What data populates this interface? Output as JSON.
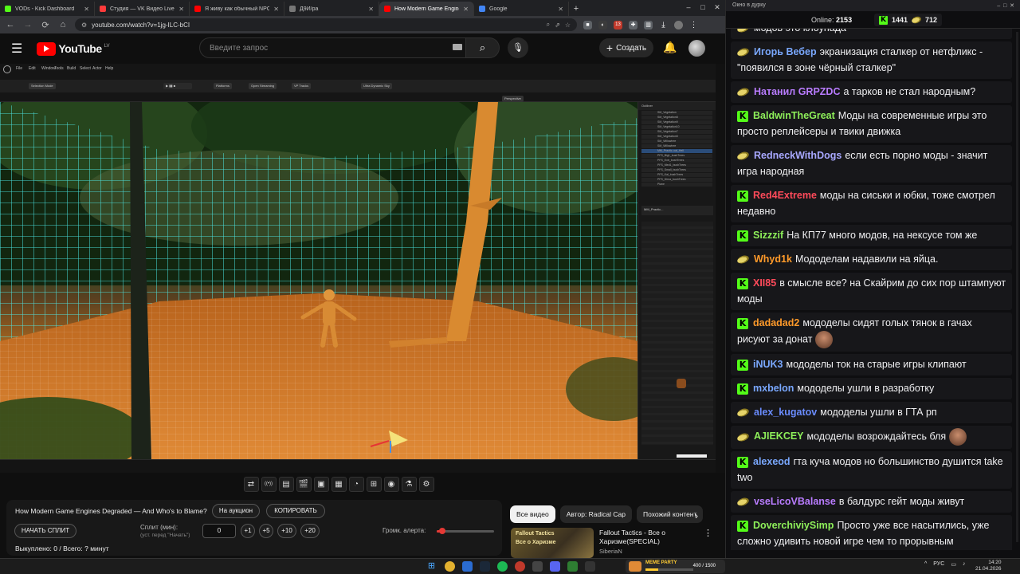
{
  "browser": {
    "tabs": [
      {
        "title": "VODs - Kick Dashboard",
        "color": "#53fc18"
      },
      {
        "title": "Студия — VK Видео Live",
        "color": "#ff3b3b"
      },
      {
        "title": "Я живу как обычный NPC в Ки",
        "color": "#ff0000"
      },
      {
        "title": "Д9И/ра",
        "color": "#777777"
      },
      {
        "title": "How Modern Game Engines De",
        "color": "#ff0000",
        "active": true
      },
      {
        "title": "Google",
        "color": "#4285f4"
      }
    ],
    "new_tab": "+",
    "url": "youtube.com/watch?v=1jg-ILC-bCI",
    "extension_badge": "13"
  },
  "youtube": {
    "logo": "YouTube",
    "country": "LV",
    "search_placeholder": "Введите запрос",
    "create_label": "Создать"
  },
  "ue": {
    "menu": [
      "File",
      "Edit",
      "Window",
      "Tools",
      "Build",
      "Select",
      "Actor",
      "Help"
    ],
    "toolbar": [
      "Selection Mode",
      "Platforms",
      "Open Streaming",
      "VP Tracks",
      "Ultra Dynamic Sky"
    ],
    "viewport_label": "Perspective",
    "outliner_rows": [
      "SM_Vegetation",
      "SM_Vegetation8",
      "SM_Vegetation9",
      "SM_Vegetation10",
      "SM_Vegetation7",
      "SM_Vegetation5",
      "SM_Willowtree",
      "SM_Willowtree",
      "MM_Practic..cal_Hell",
      "PFS_Big1_bushTrees",
      "PFS_Extr_bushTrees",
      "PFS_Med1_bushTrees",
      "PFS_Small_bushTrees",
      "PFS_Kal_bushTrees",
      "PFS_Dirna_bushTrees",
      "Plane"
    ],
    "selection": "MM_Practic..."
  },
  "controls": {
    "icons": [
      "repeat-icon",
      "broadcast-icon",
      "playlist-play-icon",
      "clapperboard-icon",
      "picture-in-picture-icon",
      "film-icon",
      "speed-icon",
      "add-box-icon",
      "camera-icon",
      "flask-icon",
      "gear-icon"
    ]
  },
  "panel": {
    "video_title": "How Modern Game Engines Degraded — And Who's to Blame?",
    "auction_label": "На аукцион",
    "copy_label": "КОПИРОВАТЬ",
    "start_split_label": "НАЧАТЬ СПЛИТ",
    "split_label": "Сплит (мин):",
    "split_hint": "(уст. перед \"Начать\")",
    "split_value": "0",
    "inc_buttons": [
      "+1",
      "+5",
      "+10",
      "+20"
    ],
    "volume_label": "Громк. алерта:",
    "volume_level": 0.1,
    "paid_out": "Выкуплено: 0 / Всего: ? минут"
  },
  "recs": {
    "chips": [
      "Все видео",
      "Автор: Radical Cap",
      "Похожий контент"
    ],
    "title": "Fallout Tactics - Все о Харизме(SPECIAL)",
    "channel": "SiberiaN",
    "thumb_text_1": "Fallout Tactics",
    "thumb_text_2": "Все о Харизме"
  },
  "chat": {
    "window_title": "Окно в дурку",
    "online_label": "Online:",
    "online_count": "2153",
    "kick_points": "1441",
    "other_points": "712",
    "messages": [
      {
        "badge": "insect",
        "user": "",
        "color": "#efeff1",
        "text": "модов это клоунада"
      },
      {
        "badge": "insect",
        "user": "Игорь Вебер",
        "color": "#7aa8ff",
        "text": "экранизация сталкер от нетфликс - \"появился в зоне чёрный сталкер\""
      },
      {
        "badge": "insect",
        "user": "Натанил  GRPZDC",
        "color": "#b97cff",
        "text": "а тарков не стал народным?"
      },
      {
        "badge": "kick",
        "user": "BaldwinTheGreat",
        "color": "#8ef05a",
        "text": "Моды на современные игры это просто реплейсеры и твики движка"
      },
      {
        "badge": "insect",
        "user": "RedneckWithDogs",
        "color": "#a8a8ff",
        "text": "если есть порно моды - значит игра народная"
      },
      {
        "badge": "kick",
        "user": "Red4Extreme",
        "color": "#ff4a5a",
        "text": "моды на сиськи и юбки, тоже смотрел недавно"
      },
      {
        "badge": "kick",
        "user": "Sizzzif",
        "color": "#8ef05a",
        "text": "На КП77 много модов, на нексусе том же"
      },
      {
        "badge": "insect",
        "user": "Whyd1k",
        "color": "#ff9a2a",
        "text": "Мододелам надавили на яйца."
      },
      {
        "badge": "kick",
        "user": "XII85",
        "color": "#ff4a5a",
        "text": "в смысле все? на Скайрим до сих пор штампуют моды"
      },
      {
        "badge": "kick",
        "user": "dadadad2",
        "color": "#ff9a2a",
        "text": "мододелы сидят голых тянок в гачах рисуют за донат",
        "emote": true
      },
      {
        "badge": "kick",
        "user": "iNUK3",
        "color": "#7aa8ff",
        "text": "мододелы ток на старые игры клипают"
      },
      {
        "badge": "kick",
        "user": "mxbelon",
        "color": "#7aa8ff",
        "text": "мододелы ушли в разработку"
      },
      {
        "badge": "insect",
        "user": "alex_kugatov",
        "color": "#6a8cff",
        "text": "мододелы ушли в ГТА рп"
      },
      {
        "badge": "insect",
        "user": "AJIEKCEY",
        "color": "#8ef05a",
        "text": "мододелы возрождайтесь бля",
        "emote": true
      },
      {
        "badge": "kick",
        "user": "alexeod",
        "color": "#7aa8ff",
        "text": "гта куча модов но большинство душится take two"
      },
      {
        "badge": "insect",
        "user": "vseLicoVBalanse",
        "color": "#b97cff",
        "text": "в балдурс гейт моды живут"
      },
      {
        "badge": "kick",
        "user": "DoverchiviySimp",
        "color": "#8ef05a",
        "text": "Просто уже все насытились, уже сложно удивить новой игре чем то прорывным"
      }
    ]
  },
  "taskbar": {
    "widget_label": "MEME PARTY",
    "widget_count": "400 / 1500",
    "widget_progress": 0.27,
    "lang": "РУС",
    "time": "14:20",
    "date": "21.04.2026"
  }
}
